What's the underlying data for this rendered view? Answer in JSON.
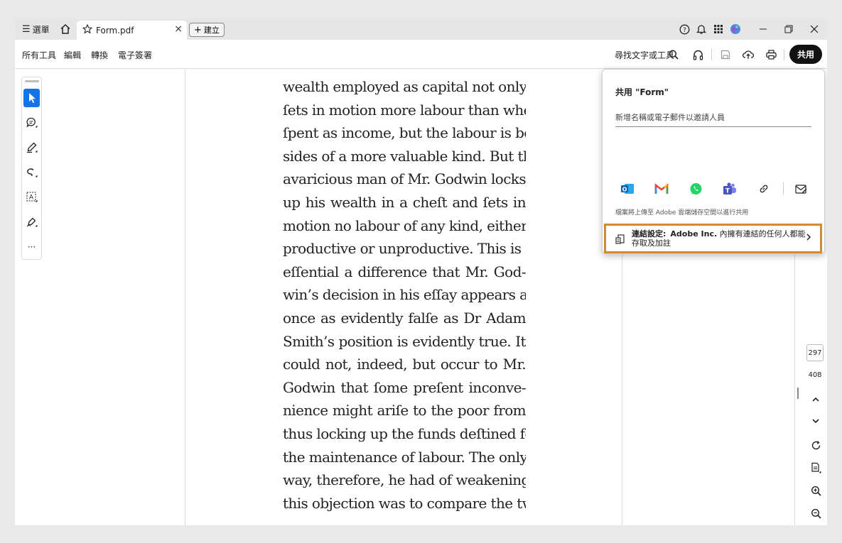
{
  "titlebar": {
    "menu_label": "選單",
    "tab_title": "Form.pdf",
    "tab_close": "×",
    "create_label": "建立",
    "create_plus": "+",
    "icons": [
      "home-icon",
      "star-icon",
      "help-icon",
      "bell-icon",
      "apps-grid-icon",
      "avatar",
      "minimize-icon",
      "restore-icon",
      "close-icon"
    ]
  },
  "menubar": {
    "items": [
      "所有工具",
      "編輯",
      "轉換",
      "電子簽署"
    ],
    "find_label": "尋找文字或工具",
    "share_label": "共用"
  },
  "tools": [
    "select-tool-icon",
    "comment-tool-icon",
    "highlight-tool-icon",
    "draw-tool-icon",
    "text-select-tool-icon",
    "fill-sign-tool-icon",
    "more-tools-icon"
  ],
  "more_tools": "···",
  "document": {
    "lines": [
      "wealth employed as capital not only",
      "ſets in motion more labour than when",
      "ſpent as income, but the labour is be-",
      "sides of a more valuable kind. But the",
      "avaricious man of Mr. Godwin locks",
      "up his wealth in a cheſt and ſets in",
      "motion no labour of any kind, either",
      "productive or unproductive. This is ſo",
      "eſſential a difference that Mr. God-",
      "win’s decision in his eſſay appears at",
      "once as evidently falſe as Dr Adam",
      "Smith’s position is evidently true. It",
      "could not, indeed, but occur to Mr.",
      "Godwin that ſome preſent inconve-",
      "nience might ariſe to the poor from",
      "thus locking up the funds deſtined for",
      "the maintenance of labour. The only",
      "way, therefore, he had of weakening",
      "this objection was to compare the two"
    ]
  },
  "pagination": {
    "current": "297",
    "total": "408"
  },
  "share_popover": {
    "title": "共用 \"Form\"",
    "invite_placeholder": "新增名稱或電子郵件以邀請人員",
    "apps": [
      "outlook-icon",
      "gmail-icon",
      "whatsapp-icon",
      "teams-icon",
      "copy-link-icon",
      "email-icon"
    ],
    "upload_note": "檔案將上傳至 Adobe 雲端儲存空間以進行共用",
    "link_settings_label": "連結設定:",
    "link_settings_org": "Adobe Inc.",
    "link_settings_desc": "內擁有連結的任何人都能存取及加註",
    "highlight_color": "#d4892e"
  },
  "colors": {
    "accent": "#1473e6",
    "share_button": "#111111"
  }
}
